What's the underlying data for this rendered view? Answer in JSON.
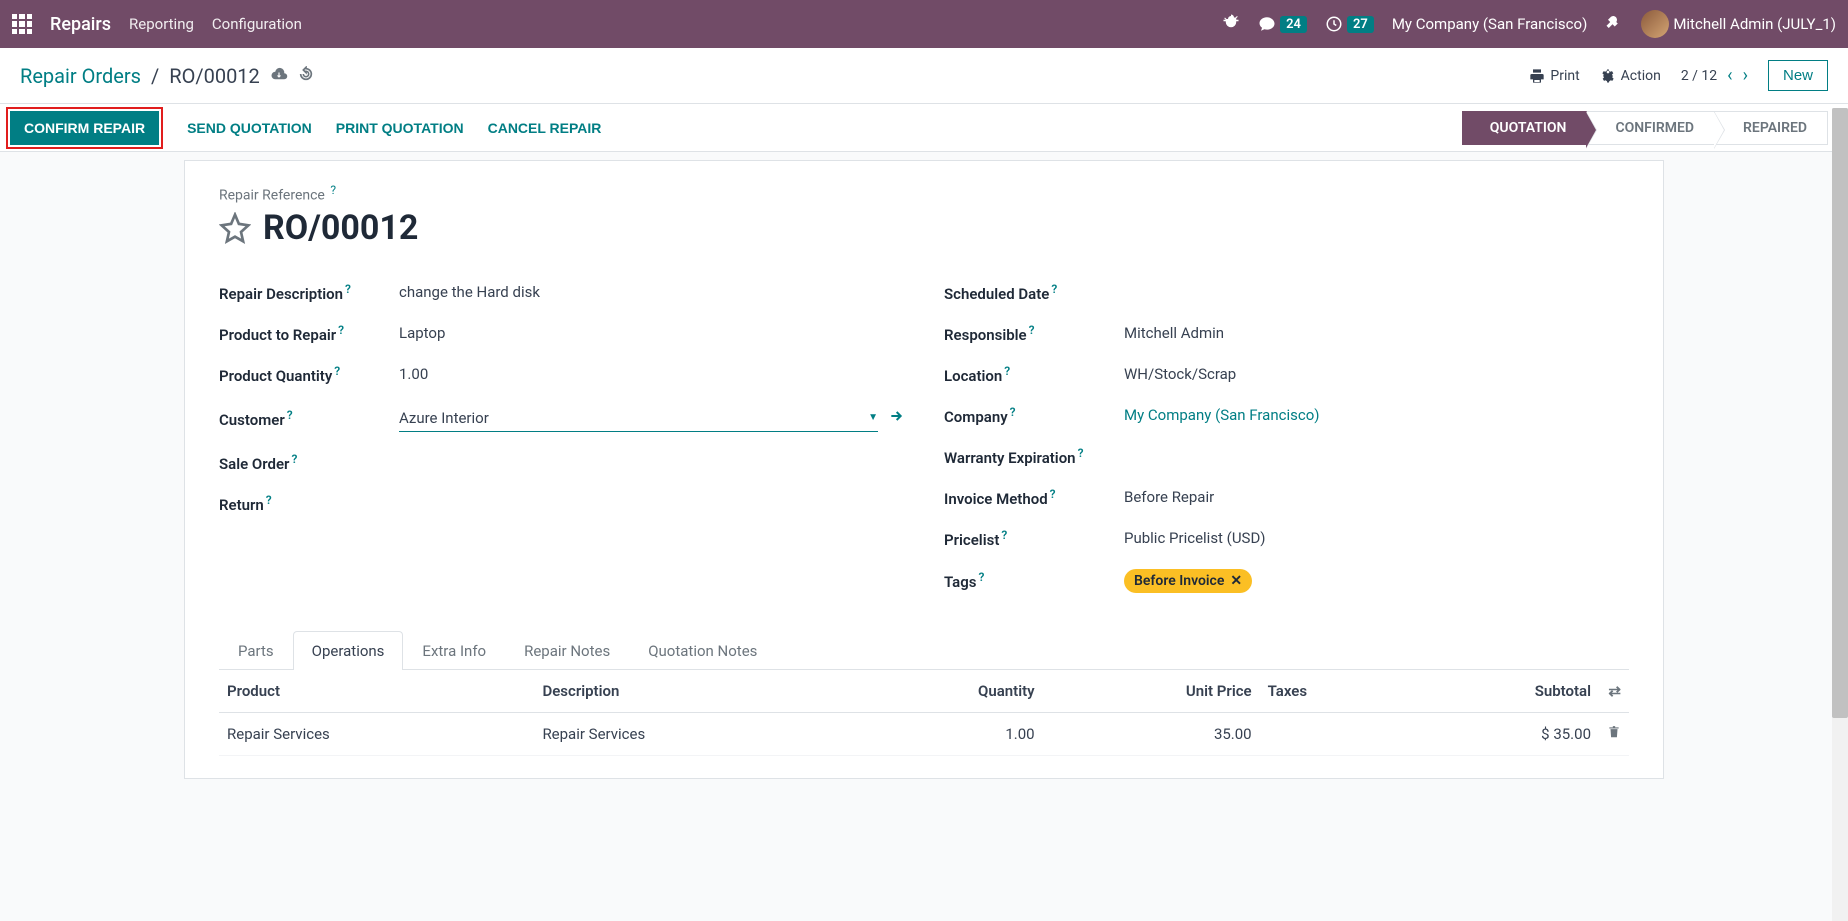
{
  "topnav": {
    "brand": "Repairs",
    "menu1": "Reporting",
    "menu2": "Configuration",
    "msg_count": "24",
    "act_count": "27",
    "company": "My Company (San Francisco)",
    "user": "Mitchell Admin (JULY_1)"
  },
  "control": {
    "breadcrumb_root": "Repair Orders",
    "breadcrumb_current": "RO/00012",
    "print": "Print",
    "action": "Action",
    "pager": "2 / 12",
    "new_btn": "New"
  },
  "actions": {
    "confirm": "CONFIRM REPAIR",
    "send": "SEND QUOTATION",
    "print": "PRINT QUOTATION",
    "cancel": "CANCEL REPAIR"
  },
  "status": {
    "s1": "QUOTATION",
    "s2": "CONFIRMED",
    "s3": "REPAIRED"
  },
  "record": {
    "ref_label": "Repair Reference",
    "title": "RO/00012",
    "left": {
      "desc_label": "Repair Description",
      "desc_value": "change the Hard disk",
      "product_label": "Product to Repair",
      "product_value": "Laptop",
      "qty_label": "Product Quantity",
      "qty_value": "1.00",
      "customer_label": "Customer",
      "customer_value": "Azure Interior",
      "sale_label": "Sale Order",
      "return_label": "Return"
    },
    "right": {
      "sched_label": "Scheduled Date",
      "resp_label": "Responsible",
      "resp_value": "Mitchell Admin",
      "loc_label": "Location",
      "loc_value": "WH/Stock/Scrap",
      "company_label": "Company",
      "company_value": "My Company (San Francisco)",
      "warranty_label": "Warranty Expiration",
      "invoice_label": "Invoice Method",
      "invoice_value": "Before Repair",
      "pricelist_label": "Pricelist",
      "pricelist_value": "Public Pricelist (USD)",
      "tags_label": "Tags",
      "tag_value": "Before Invoice"
    }
  },
  "tabs": {
    "t1": "Parts",
    "t2": "Operations",
    "t3": "Extra Info",
    "t4": "Repair Notes",
    "t5": "Quotation Notes"
  },
  "table": {
    "h_product": "Product",
    "h_desc": "Description",
    "h_qty": "Quantity",
    "h_price": "Unit Price",
    "h_taxes": "Taxes",
    "h_subtotal": "Subtotal",
    "r1_product": "Repair Services",
    "r1_desc": "Repair Services",
    "r1_qty": "1.00",
    "r1_price": "35.00",
    "r1_subtotal": "$ 35.00"
  }
}
